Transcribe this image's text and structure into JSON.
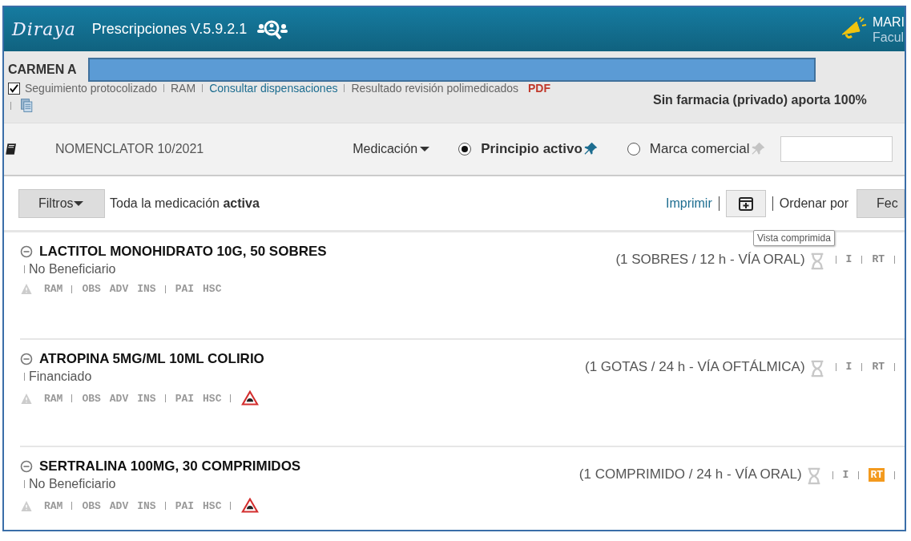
{
  "header": {
    "logo": "Diraya",
    "title": "Prescripciones V.5.9.2.1",
    "user_name": "MARI",
    "user_role": "Facul"
  },
  "patient": {
    "name": "CARMEN A",
    "links": [
      {
        "kind": "checkbox",
        "label": "Seguimiento protocolizado",
        "checked": true
      },
      {
        "kind": "text",
        "label": "RAM"
      },
      {
        "kind": "link",
        "label": "Consultar dispensaciones"
      },
      {
        "kind": "text",
        "label": "Resultado revisión polimedicados"
      },
      {
        "kind": "pdf",
        "label": "PDF"
      }
    ],
    "pharmacy": "Sin farmacia (privado) aporta 100%"
  },
  "search": {
    "catalog": "NOMENCLATOR 10/2021",
    "dropdown": "Medicación",
    "options": [
      {
        "label": "Principio activo",
        "selected": true
      },
      {
        "label": "Marca comercial",
        "selected": false
      }
    ]
  },
  "toolbar": {
    "filter_button": "Filtros",
    "filter_summary": "Toda la medicación **activa**",
    "print_link": "Imprimir",
    "sort_label": "Ordenar por",
    "sort_button": "Fec",
    "tooltip": "Vista comprimida"
  },
  "medications": [
    {
      "name": "LACTITOL MONOHIDRATO 10G, 50 SOBRES",
      "funding": "No Beneficiario",
      "dosage": "(1 SOBRES / 12 h - VÍA ORAL)",
      "tag_groups": [
        [
          "RAM"
        ],
        [
          "OBS",
          "ADV",
          "INS"
        ],
        [
          "PAI",
          "HSC"
        ]
      ],
      "driving_warning": false,
      "right_tags": [
        {
          "label": "I",
          "highlighted": false
        },
        {
          "label": "RT",
          "highlighted": false
        }
      ]
    },
    {
      "name": "ATROPINA 5MG/ML 10ML COLIRIO",
      "funding": "Financiado",
      "dosage": "(1 GOTAS / 24 h - VÍA OFTÁLMICA)",
      "tag_groups": [
        [
          "RAM"
        ],
        [
          "OBS",
          "ADV",
          "INS"
        ],
        [
          "PAI",
          "HSC"
        ]
      ],
      "driving_warning": true,
      "right_tags": [
        {
          "label": "I",
          "highlighted": false
        },
        {
          "label": "RT",
          "highlighted": false
        }
      ]
    },
    {
      "name": "SERTRALINA 100MG, 30 COMPRIMIDOS",
      "funding": "No Beneficiario",
      "dosage": "(1 COMPRIMIDO / 24 h - VÍA ORAL)",
      "tag_groups": [
        [
          "RAM"
        ],
        [
          "OBS",
          "ADV",
          "INS"
        ],
        [
          "PAI",
          "HSC"
        ]
      ],
      "driving_warning": true,
      "right_tags": [
        {
          "label": "I",
          "highlighted": false
        },
        {
          "label": "RT",
          "highlighted": true
        }
      ]
    }
  ]
}
